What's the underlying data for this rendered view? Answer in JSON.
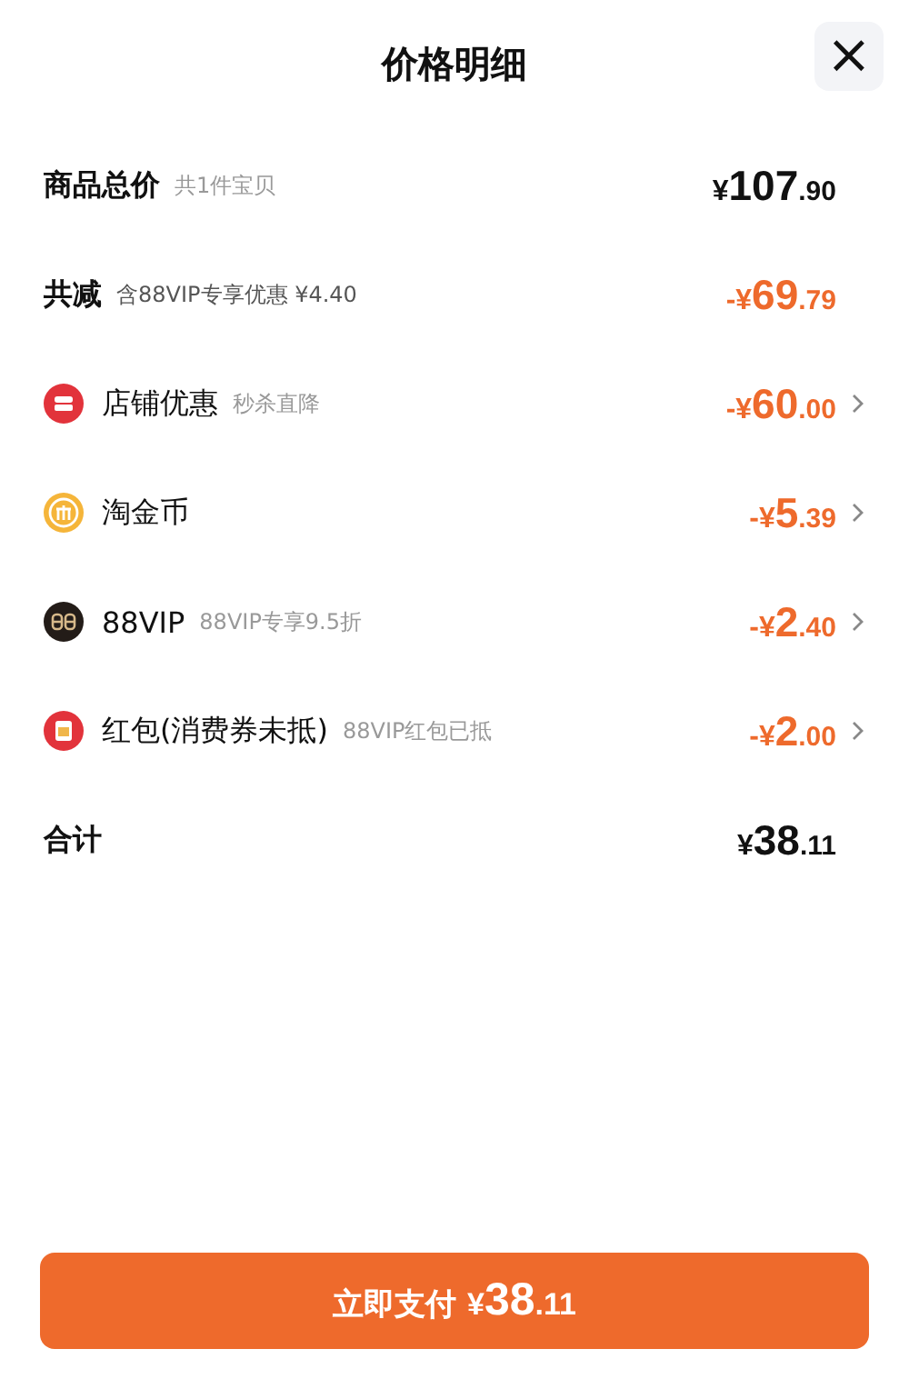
{
  "header": {
    "title": "价格明细",
    "close": "×"
  },
  "rows": [
    {
      "kind": "summary",
      "label": "商品总价",
      "note": "共1件宝贝",
      "amount": {
        "prefix": "¥",
        "integer": "107",
        "decimal": ".90"
      },
      "highlight": false
    },
    {
      "kind": "summary",
      "label": "共减",
      "note": "含88VIP专享优惠 ¥4.40",
      "amount": {
        "prefix": "-¥",
        "integer": "69",
        "decimal": ".79"
      },
      "highlight": true
    },
    {
      "kind": "store",
      "label": "店铺优惠",
      "note": "秒杀直降",
      "amount": {
        "prefix": "-¥",
        "integer": "60",
        "decimal": ".00"
      },
      "highlight": true
    },
    {
      "kind": "coin",
      "label": "淘金币",
      "amount": {
        "prefix": "-¥",
        "integer": "5",
        "decimal": ".39"
      },
      "highlight": true
    },
    {
      "kind": "vip",
      "label": "88VIP",
      "note": "88VIP专享9.5折",
      "amount": {
        "prefix": "-¥",
        "integer": "2",
        "decimal": ".40"
      },
      "highlight": true
    },
    {
      "kind": "voucher",
      "label": "红包(消费券未抵)",
      "note": "88VIP红包已抵",
      "amount": {
        "prefix": "-¥",
        "integer": "2",
        "decimal": ".00"
      },
      "highlight": true
    },
    {
      "kind": "summary",
      "label": "合计",
      "amount": {
        "prefix": "¥",
        "integer": "38",
        "decimal": ".11"
      },
      "highlight": false
    }
  ],
  "pay_button": {
    "label": "立即支付",
    "amount": {
      "prefix": "¥",
      "integer": "38",
      "decimal": ".11"
    }
  }
}
